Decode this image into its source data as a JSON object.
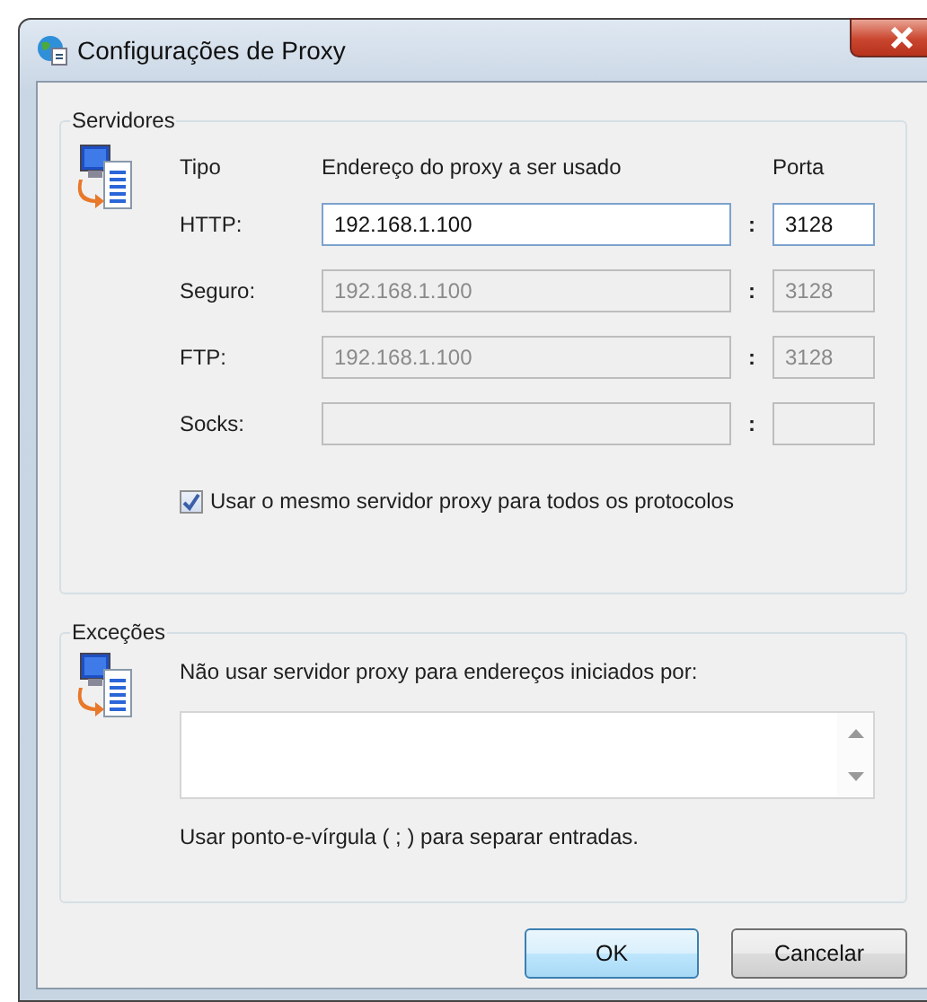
{
  "window": {
    "title": "Configurações de Proxy"
  },
  "servers": {
    "title": "Servidores",
    "headers": {
      "type": "Tipo",
      "address": "Endereço do proxy a ser usado",
      "port": "Porta"
    },
    "rows": [
      {
        "label": "HTTP:",
        "address": "192.168.1.100",
        "separator": ":",
        "port": "3128",
        "disabled": false
      },
      {
        "label": "Seguro:",
        "address": "192.168.1.100",
        "separator": ":",
        "port": "3128",
        "disabled": true
      },
      {
        "label": "FTP:",
        "address": "192.168.1.100",
        "separator": ":",
        "port": "3128",
        "disabled": true
      },
      {
        "label": "Socks:",
        "separator": ":",
        "disabled": true
      }
    ],
    "same_proxy": {
      "label": "Usar o mesmo servidor proxy para todos os protocolos",
      "checked": true
    }
  },
  "exceptions": {
    "title": "Exceções",
    "label": "Não usar servidor proxy para endereços iniciados por:",
    "hint": "Usar ponto-e-vírgula ( ; ) para separar entradas."
  },
  "buttons": [
    {
      "label": "OK",
      "default": true
    },
    {
      "label": "Cancelar",
      "default": false
    }
  ]
}
